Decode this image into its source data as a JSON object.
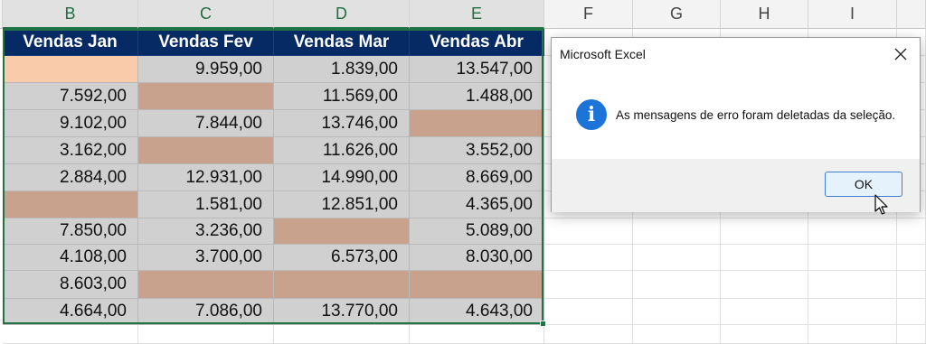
{
  "columns": [
    {
      "letter": "B",
      "selected": true
    },
    {
      "letter": "C",
      "selected": true
    },
    {
      "letter": "D",
      "selected": true
    },
    {
      "letter": "E",
      "selected": true
    },
    {
      "letter": "F",
      "selected": false
    },
    {
      "letter": "G",
      "selected": false
    },
    {
      "letter": "H",
      "selected": false
    },
    {
      "letter": "I",
      "selected": false
    }
  ],
  "table": {
    "headers": [
      "Vendas Jan",
      "Vendas Fev",
      "Vendas Mar",
      "Vendas Abr"
    ],
    "rows": [
      [
        "",
        "9.959,00",
        "1.839,00",
        "13.547,00"
      ],
      [
        "7.592,00",
        "",
        "11.569,00",
        "1.488,00"
      ],
      [
        "9.102,00",
        "7.844,00",
        "13.746,00",
        ""
      ],
      [
        "3.162,00",
        "",
        "11.626,00",
        "3.552,00"
      ],
      [
        "2.884,00",
        "12.931,00",
        "14.990,00",
        "8.669,00"
      ],
      [
        "",
        "1.581,00",
        "12.851,00",
        "4.365,00"
      ],
      [
        "7.850,00",
        "3.236,00",
        "",
        "5.089,00"
      ],
      [
        "4.108,00",
        "3.700,00",
        "6.573,00",
        "8.030,00"
      ],
      [
        "8.603,00",
        "",
        "",
        ""
      ],
      [
        "4.664,00",
        "7.086,00",
        "13.770,00",
        "4.643,00"
      ]
    ]
  },
  "colors": {
    "header_bg": "#062a63",
    "value_cell_bg": "#d0d0d0",
    "error_cleared_bg": "#c8a28c",
    "active_cell_bg": "#f9cbab",
    "selection_border": "#217346",
    "info_icon": "#1c73d8"
  },
  "dialog": {
    "title": "Microsoft Excel",
    "message": "As mensagens de erro foram deletadas da seleção.",
    "icon": "info-icon",
    "info_glyph": "i",
    "close_icon": "close-icon",
    "ok_label": "OK"
  }
}
